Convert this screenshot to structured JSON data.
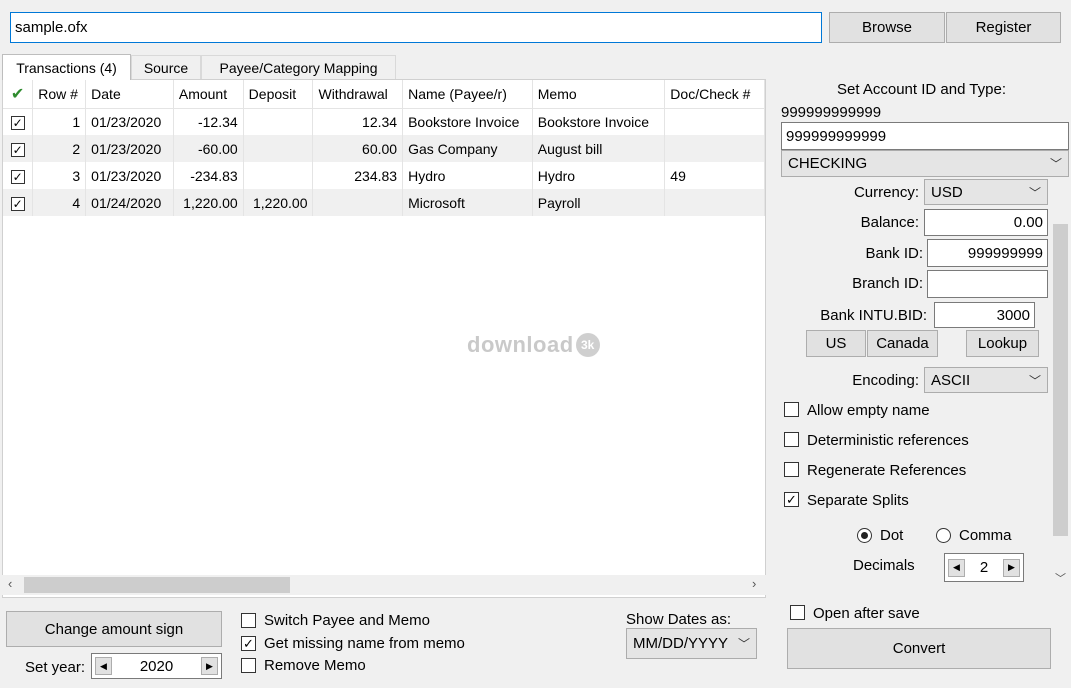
{
  "file": {
    "path_value": "sample.ofx",
    "browse_label": "Browse",
    "register_label": "Register"
  },
  "tabs": [
    {
      "label": "Transactions (4)"
    },
    {
      "label": "Source"
    },
    {
      "label": "Payee/Category Mapping"
    }
  ],
  "grid": {
    "columns": [
      "Row #",
      "Date",
      "Amount",
      "Deposit",
      "Withdrawal",
      "Name (Payee/r)",
      "Memo",
      "Doc/Check #"
    ],
    "rows": [
      {
        "row": "1",
        "date": "01/23/2020",
        "amount": "-12.34",
        "deposit": "",
        "withdrawal": "12.34",
        "name": "Bookstore Invoice",
        "memo": "Bookstore Invoice",
        "doc": ""
      },
      {
        "row": "2",
        "date": "01/23/2020",
        "amount": "-60.00",
        "deposit": "",
        "withdrawal": "60.00",
        "name": "Gas Company",
        "memo": "August bill",
        "doc": ""
      },
      {
        "row": "3",
        "date": "01/23/2020",
        "amount": "-234.83",
        "deposit": "",
        "withdrawal": "234.83",
        "name": "Hydro",
        "memo": "Hydro",
        "doc": "49"
      },
      {
        "row": "4",
        "date": "01/24/2020",
        "amount": "1,220.00",
        "deposit": "1,220.00",
        "withdrawal": "",
        "name": "Microsoft",
        "memo": "Payroll",
        "doc": ""
      }
    ]
  },
  "watermark": {
    "text": "download",
    "badge": "3k"
  },
  "account": {
    "heading": "Set Account ID and Type:",
    "id_display": "999999999999",
    "id_value": "999999999999",
    "type_value": "CHECKING",
    "currency_label": "Currency:",
    "currency_value": "USD",
    "balance_label": "Balance:",
    "balance_value": "0.00",
    "bank_id_label": "Bank ID:",
    "bank_id_value": "999999999",
    "branch_id_label": "Branch ID:",
    "branch_id_value": "",
    "intu_label": "Bank INTU.BID:",
    "intu_value": "3000",
    "us_label": "US",
    "canada_label": "Canada",
    "lookup_label": "Lookup",
    "encoding_label": "Encoding:",
    "encoding_value": "ASCII"
  },
  "options": {
    "allow_empty_name": "Allow empty name",
    "deterministic_refs": "Deterministic references",
    "regenerate_refs": "Regenerate References",
    "separate_splits": "Separate Splits",
    "dot_label": "Dot",
    "comma_label": "Comma",
    "decimals_label": "Decimals",
    "decimals_value": "2",
    "open_after_save": "Open after save",
    "convert_label": "Convert"
  },
  "bottom": {
    "change_sign_label": "Change amount sign",
    "set_year_label": "Set year:",
    "year_value": "2020",
    "switch_payee_memo": "Switch Payee and Memo",
    "get_missing_name": "Get missing name from memo",
    "remove_memo": "Remove Memo",
    "show_dates_label": "Show Dates as:",
    "date_format_value": "MM/DD/YYYY"
  },
  "colors": {
    "accent_border": "#0078d7",
    "check_green": "#2e8b2e"
  }
}
